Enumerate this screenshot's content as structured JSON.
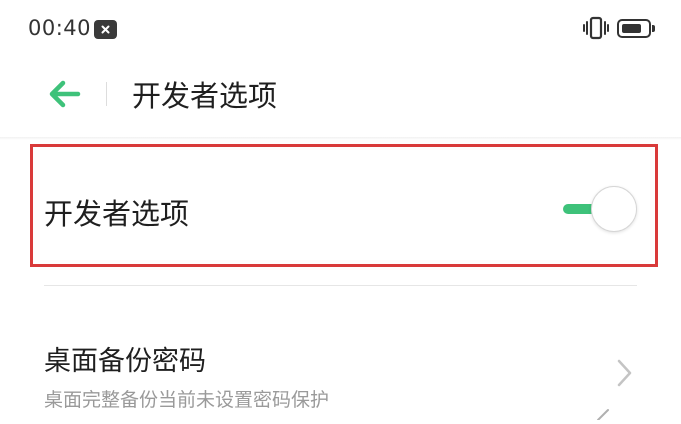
{
  "status_bar": {
    "time": "00:40",
    "notification_icon": "close-box-icon",
    "vibrate_icon": "vibrate-icon",
    "battery_icon": "battery-icon"
  },
  "header": {
    "back_icon": "arrow-left-icon",
    "title": "开发者选项"
  },
  "developer_options": {
    "label": "开发者选项",
    "enabled": true,
    "highlight_color": "#d93a3a"
  },
  "backup_password": {
    "title": "桌面备份密码",
    "subtitle": "桌面完整备份当前未设置密码保护",
    "chevron_icon": "chevron-right-icon"
  },
  "colors": {
    "accent": "#3ec27a",
    "text_primary": "#1f1f1f",
    "text_secondary": "#9a9a9a"
  }
}
